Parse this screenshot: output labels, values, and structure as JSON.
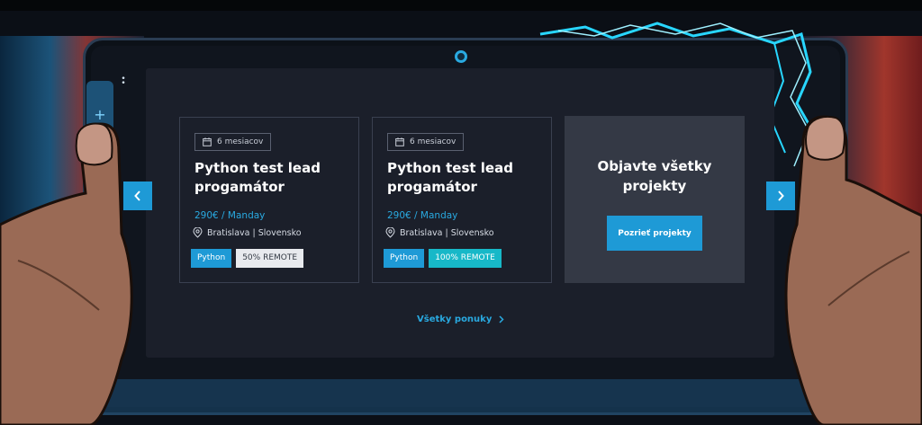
{
  "cards": [
    {
      "duration": "6 mesiacov",
      "title_line1": "Python test lead",
      "title_line2": "progamátor",
      "salary": "290€ / Manday",
      "location": "Bratislava | Slovensko",
      "tags": [
        "Python",
        "50% REMOTE"
      ]
    },
    {
      "duration": "6 mesiacov",
      "title_line1": "Python test lead",
      "title_line2": "progamátor",
      "salary": "290€ / Manday",
      "location": "Bratislava | Slovensko",
      "tags": [
        "Python",
        "100% REMOTE"
      ]
    }
  ],
  "promo": {
    "title_line1": "Objavte všetky",
    "title_line2": "projekty",
    "button_label": "Pozrieť projekty"
  },
  "all_offers_label": "Všetky ponuky",
  "icons": {
    "duration": "calendar-icon",
    "location": "map-pin-icon",
    "prev": "chevron-left-icon",
    "next": "chevron-right-icon",
    "link": "chevron-right-icon"
  },
  "colors": {
    "accent": "#1e9ad6",
    "tag_teal": "#17b8c8",
    "tag_light": "#e8eaee",
    "screen_bg": "#1b1f2a",
    "promo_bg": "#343945"
  }
}
